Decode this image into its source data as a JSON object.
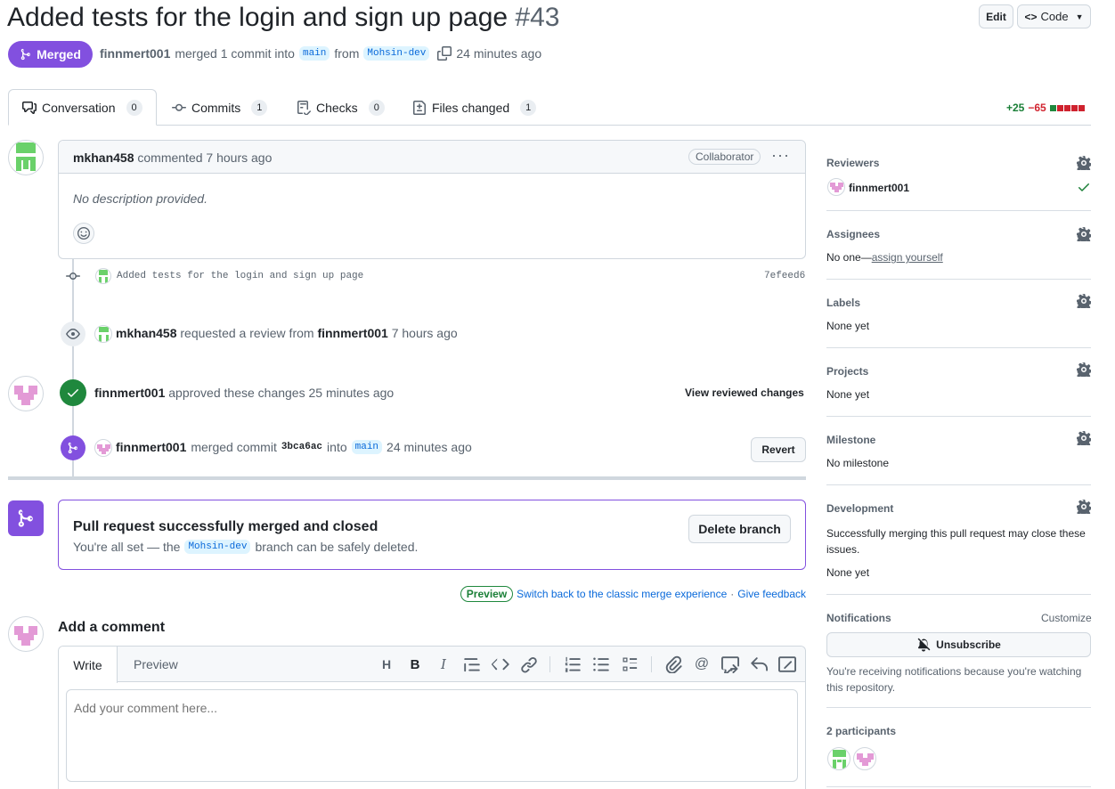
{
  "pr": {
    "title": "Added tests for the login and sign up page",
    "number": "#43",
    "state": "Merged",
    "author": "finnmert001",
    "merged_text": "merged 1 commit into",
    "base_branch": "main",
    "from_text": "from",
    "head_branch": "Mohsin-dev",
    "time": "24 minutes ago"
  },
  "header_buttons": {
    "edit": "Edit",
    "code": "Code"
  },
  "tabs": [
    {
      "label": "Conversation",
      "count": "0"
    },
    {
      "label": "Commits",
      "count": "1"
    },
    {
      "label": "Checks",
      "count": "0"
    },
    {
      "label": "Files changed",
      "count": "1"
    }
  ],
  "diffstat": {
    "additions": "+25",
    "deletions": "−65"
  },
  "comment": {
    "author": "mkhan458",
    "meta": "commented 7 hours ago",
    "badge": "Collaborator",
    "body": "No description provided."
  },
  "commit": {
    "message": "Added tests for the login and sign up page",
    "sha": "7efeed6"
  },
  "review_request": {
    "actor": "mkhan458",
    "text": "requested a review from",
    "target": "finnmert001",
    "time": "7 hours ago"
  },
  "approval": {
    "actor": "finnmert001",
    "text": "approved these changes 25 minutes ago",
    "link": "View reviewed changes"
  },
  "merge_event": {
    "actor": "finnmert001",
    "text": "merged commit",
    "sha": "3bca6ac",
    "into": "into",
    "branch": "main",
    "time": "24 minutes ago",
    "revert": "Revert"
  },
  "merged_box": {
    "title": "Pull request successfully merged and closed",
    "desc_pre": "You're all set — the",
    "branch": "Mohsin-dev",
    "desc_post": "branch can be safely deleted.",
    "delete_button": "Delete branch"
  },
  "preview_bar": {
    "badge": "Preview",
    "switch": "Switch back to the classic merge experience",
    "sep": "·",
    "feedback": "Give feedback"
  },
  "add_comment": {
    "title": "Add a comment",
    "tab_write": "Write",
    "tab_preview": "Preview",
    "placeholder": "Add your comment here..."
  },
  "toolbar_icons": [
    "heading-icon",
    "bold-icon",
    "italic-icon",
    "quote-icon",
    "code-icon",
    "link-icon",
    "numbered-list-icon",
    "bulleted-list-icon",
    "task-list-icon",
    "attach-icon",
    "mention-icon",
    "reference-icon",
    "reply-icon",
    "fullscreen-icon"
  ],
  "sidebar": {
    "reviewers": {
      "title": "Reviewers",
      "name": "finnmert001"
    },
    "assignees": {
      "title": "Assignees",
      "none": "No one—",
      "link": "assign yourself"
    },
    "labels": {
      "title": "Labels",
      "value": "None yet"
    },
    "projects": {
      "title": "Projects",
      "value": "None yet"
    },
    "milestone": {
      "title": "Milestone",
      "value": "No milestone"
    },
    "development": {
      "title": "Development",
      "desc": "Successfully merging this pull request may close these issues.",
      "value": "None yet"
    },
    "notifications": {
      "title": "Notifications",
      "customize": "Customize",
      "button": "Unsubscribe",
      "desc": "You're receiving notifications because you're watching this repository."
    },
    "participants": {
      "title": "2 participants"
    }
  },
  "colors": {
    "merged": "#8250df",
    "approved": "#1f883d",
    "link": "#0969da",
    "add": "#1a7f37",
    "del": "#d1242f"
  }
}
